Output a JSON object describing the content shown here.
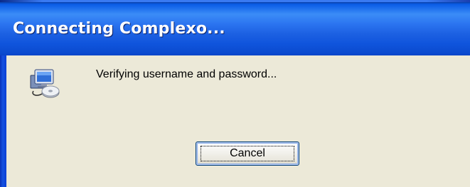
{
  "window": {
    "title": "Connecting Complexo...",
    "title_color": "#ffffff",
    "titlebar_color": "#0a5ce6",
    "client_bg": "#ece9d8"
  },
  "dialog": {
    "icon": "network-connection-icon",
    "message": "Verifying username and password...",
    "cancel_label": "Cancel"
  }
}
